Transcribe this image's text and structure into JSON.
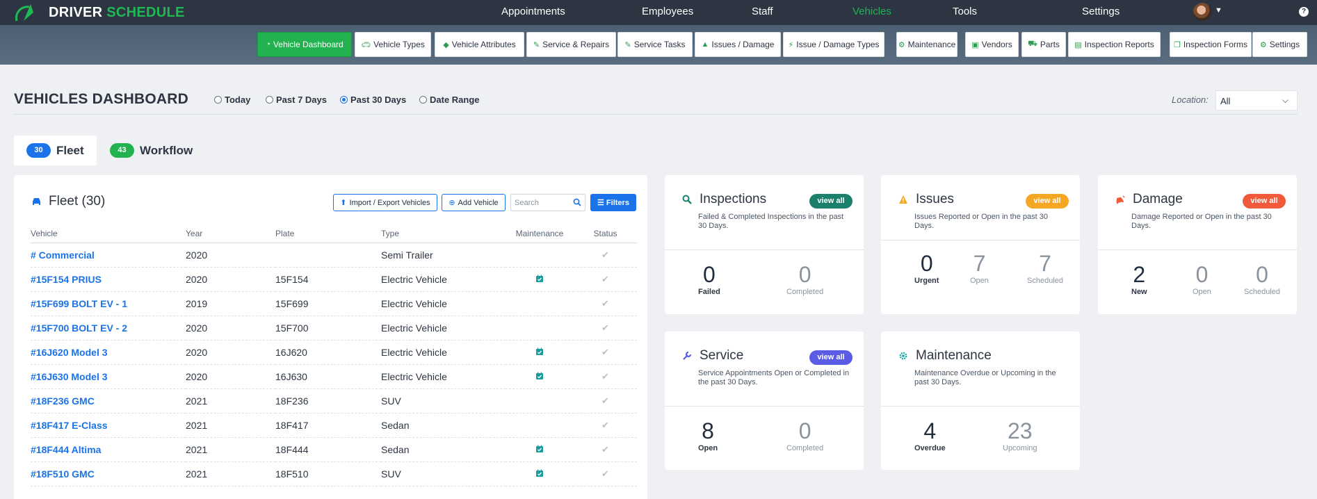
{
  "app": {
    "brand_a": "DRIVER",
    "brand_b": "SCHEDULE"
  },
  "topnav": [
    "Appointments",
    "Employees",
    "Staff",
    "Vehicles",
    "Tools",
    "Settings"
  ],
  "subnav": [
    "Vehicle Dashboard",
    "Vehicle Types",
    "Vehicle Attributes",
    "Service & Repairs",
    "Service Tasks",
    "Issues / Damage",
    "Issue / Damage Types",
    "Maintenance",
    "Vendors",
    "Parts",
    "Inspection Reports",
    "Inspection Forms",
    "Settings"
  ],
  "header": {
    "title": "VEHICLES DASHBOARD",
    "ranges": [
      "Today",
      "Past 7 Days",
      "Past 30 Days",
      "Date Range"
    ],
    "selected_range": "Past 30 Days",
    "location_label": "Location:",
    "location_value": "All"
  },
  "tabs": [
    {
      "count": "30",
      "label": "Fleet"
    },
    {
      "count": "43",
      "label": "Workflow"
    }
  ],
  "fleet": {
    "title": "Fleet (30)",
    "import_label": "Import / Export Vehicles",
    "add_label": "Add Vehicle",
    "search_placeholder": "Search",
    "filters_label": "Filters",
    "columns": [
      "Vehicle",
      "Year",
      "Plate",
      "Type",
      "Maintenance",
      "Status"
    ],
    "rows": [
      {
        "vehicle": "# Commercial",
        "year": "2020",
        "plate": "",
        "type": "Semi Trailer",
        "maint": false
      },
      {
        "vehicle": "#15F154 PRIUS",
        "year": "2020",
        "plate": "15F154",
        "type": "Electric Vehicle",
        "maint": true
      },
      {
        "vehicle": "#15F699 BOLT EV - 1",
        "year": "2019",
        "plate": "15F699",
        "type": "Electric Vehicle",
        "maint": false
      },
      {
        "vehicle": "#15F700 BOLT EV - 2",
        "year": "2020",
        "plate": "15F700",
        "type": "Electric Vehicle",
        "maint": false
      },
      {
        "vehicle": "#16J620 Model 3",
        "year": "2020",
        "plate": "16J620",
        "type": "Electric Vehicle",
        "maint": true
      },
      {
        "vehicle": "#16J630 Model 3",
        "year": "2020",
        "plate": "16J630",
        "type": "Electric Vehicle",
        "maint": true
      },
      {
        "vehicle": "#18F236 GMC",
        "year": "2021",
        "plate": "18F236",
        "type": "SUV",
        "maint": false
      },
      {
        "vehicle": "#18F417 E-Class",
        "year": "2021",
        "plate": "18F417",
        "type": "Sedan",
        "maint": false
      },
      {
        "vehicle": "#18F444 Altima",
        "year": "2021",
        "plate": "18F444",
        "type": "Sedan",
        "maint": true
      },
      {
        "vehicle": "#18F510 GMC",
        "year": "2021",
        "plate": "18F510",
        "type": "SUV",
        "maint": true
      }
    ]
  },
  "cards": {
    "inspections": {
      "title": "Inspections",
      "sub": "Failed & Completed Inspections in the past 30 Days.",
      "view": "view all",
      "color": "#1a7f6b",
      "stats": [
        {
          "n": "0",
          "l": "Failed"
        },
        {
          "n": "0",
          "l": "Completed"
        }
      ]
    },
    "issues": {
      "title": "Issues",
      "sub": "Issues Reported or Open in the past 30 Days.",
      "view": "view all",
      "color": "#f5a623",
      "stats": [
        {
          "n": "0",
          "l": "Urgent"
        },
        {
          "n": "7",
          "l": "Open"
        },
        {
          "n": "7",
          "l": "Scheduled"
        }
      ]
    },
    "damage": {
      "title": "Damage",
      "sub": "Damage Reported or Open in the past 30 Days.",
      "view": "view all",
      "color": "#f05a3a",
      "stats": [
        {
          "n": "2",
          "l": "New"
        },
        {
          "n": "0",
          "l": "Open"
        },
        {
          "n": "0",
          "l": "Scheduled"
        }
      ]
    },
    "service": {
      "title": "Service",
      "sub": "Service Appointments Open or Completed in the past 30 Days.",
      "view": "view all",
      "color": "#5b5ce6",
      "stats": [
        {
          "n": "8",
          "l": "Open"
        },
        {
          "n": "0",
          "l": "Completed"
        }
      ]
    },
    "maintenance": {
      "title": "Maintenance",
      "sub": "Maintenance Overdue or Upcoming in the past 30 Days.",
      "stats": [
        {
          "n": "4",
          "l": "Overdue"
        },
        {
          "n": "23",
          "l": "Upcoming"
        }
      ]
    }
  }
}
